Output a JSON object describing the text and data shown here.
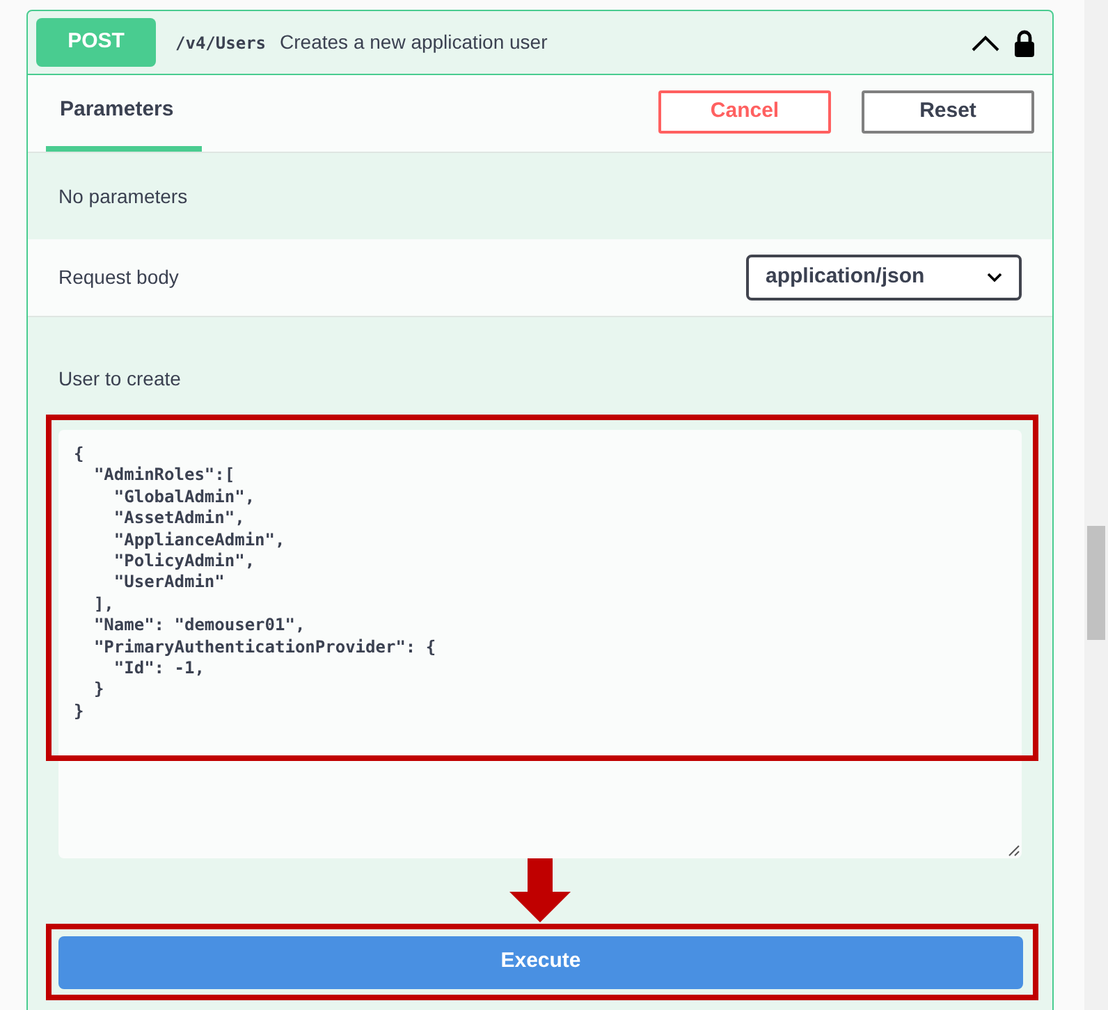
{
  "operation": {
    "method": "POST",
    "path": "/v4/Users",
    "summary": "Creates a new application user",
    "expanded": true,
    "locked": true
  },
  "tabs": [
    {
      "label": "Parameters",
      "selected": true
    }
  ],
  "buttons": {
    "cancel": "Cancel",
    "reset": "Reset",
    "execute": "Execute"
  },
  "parameters": {
    "empty_text": "No parameters"
  },
  "request_body": {
    "label": "Request body",
    "content_type": "application/json"
  },
  "body_field": {
    "label": "User to create",
    "lines": [
      "{",
      "  \"AdminRoles\":[",
      "    \"GlobalAdmin\",",
      "    \"AssetAdmin\",",
      "    \"ApplianceAdmin\",",
      "    \"PolicyAdmin\",",
      "    \"UserAdmin\"",
      "  ],",
      "  \"Name\": \"demouser01\",",
      "  \"PrimaryAuthenticationProvider\": {",
      "    \"Id\": -1,",
      "  }",
      "}"
    ]
  }
}
